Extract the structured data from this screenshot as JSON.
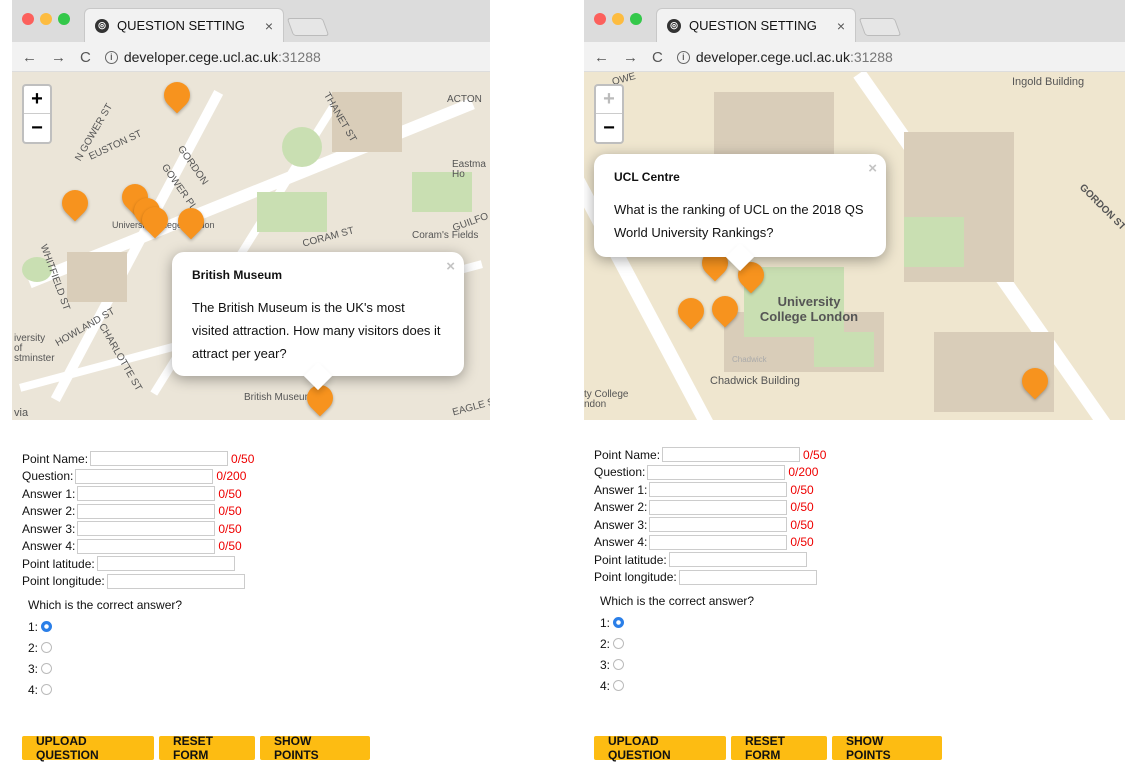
{
  "browser": {
    "tab_title": "QUESTION SETTING",
    "tab_close": "×",
    "back": "←",
    "forward": "→",
    "reload": "C",
    "url_host": "developer.cege.ucl.ac.uk",
    "url_port": ":31288"
  },
  "left": {
    "map": {
      "popup_title": "British Museum",
      "popup_text": "The British Museum is the UK's most visited attraction. How many visitors does it attract per year?",
      "labels": [
        "ACTON",
        "THANET ST",
        "N GOWER ST",
        "EUSTON ST",
        "CORAM ST",
        "Coram's Fields",
        "GUILFO",
        "WHITFIELD ST",
        "HOWLAND ST",
        "CHARLOTTE ST",
        "British Museum",
        "Eastma Ho",
        "UniversityCollege London",
        "iversity of stminster",
        "GORDON",
        "GOWER PL",
        "via",
        "EAGLE S"
      ]
    }
  },
  "right": {
    "map": {
      "popup_title": "UCL Centre",
      "popup_text": "What is the ranking of UCL on the 2018 QS World University Rankings?",
      "labels": [
        "Ingold Building",
        "GORDON ST",
        "University College London",
        "Chadwick Building",
        "Chadwick",
        "ty College ndon",
        "OWE"
      ]
    }
  },
  "form": {
    "point_name_label": "Point Name:",
    "point_name_counter": "0/50",
    "question_label": "Question:",
    "question_counter": "0/200",
    "answer1_label": "Answer 1:",
    "answer2_label": "Answer 2:",
    "answer3_label": "Answer 3:",
    "answer4_label": "Answer 4:",
    "answer_counter": "0/50",
    "latitude_label": "Point latitude:",
    "longitude_label": "Point longitude:",
    "correct_answer_prompt": "Which is the correct answer?",
    "options": [
      "1:",
      "2:",
      "3:",
      "4:"
    ],
    "selected_option": "1:"
  },
  "buttons": {
    "upload": "UPLOAD QUESTION",
    "reset": "RESET FORM",
    "show": "SHOW POINTS"
  },
  "map_controls": {
    "zoom_in": "+",
    "zoom_out": "−",
    "close": "×"
  },
  "colors": {
    "marker": "#f7931e",
    "counter": "#e00000",
    "button": "#fdbc12",
    "radio_checked": "#2b7fe8"
  }
}
